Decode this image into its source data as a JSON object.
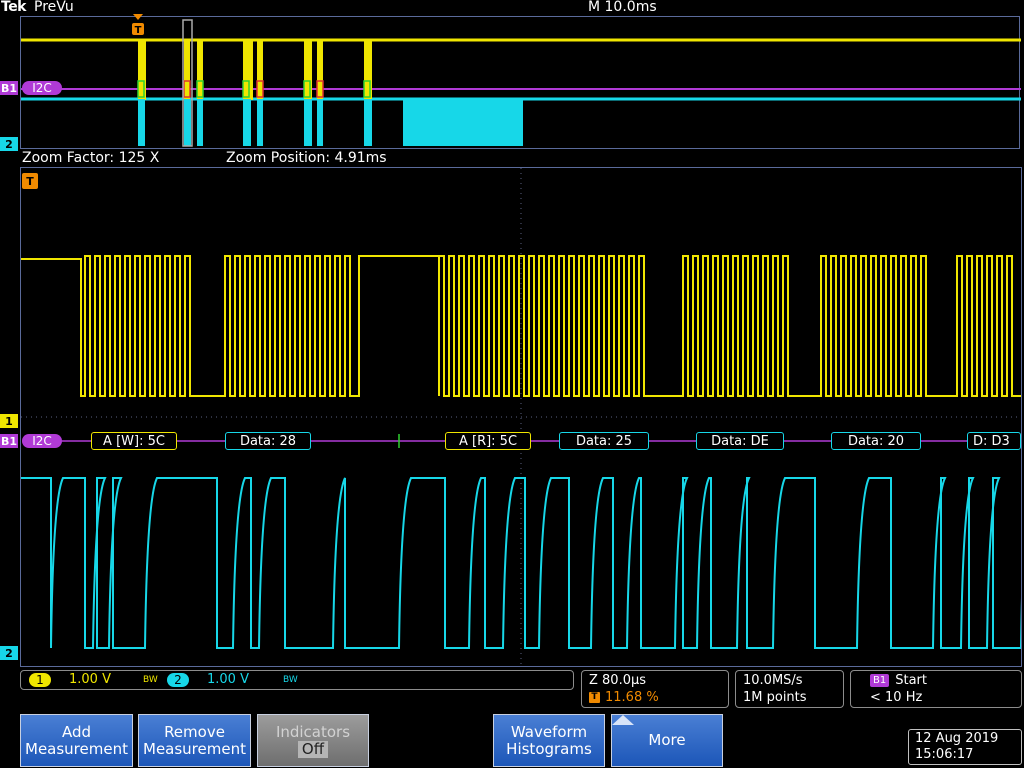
{
  "header": {
    "brand": "Tek",
    "mode": "PreVu",
    "timebase": "M 10.0ms"
  },
  "overview": {
    "trigger_marker": "T",
    "bus_label": "I2C",
    "bus_marker": "B1",
    "ch1_marker": "1",
    "ch2_marker": "2"
  },
  "zoom": {
    "factor_label": "Zoom Factor: 125 X",
    "position_label": "Zoom Position: 4.91ms"
  },
  "main": {
    "trigger_marker": "T",
    "ch1_marker": "1",
    "ch2_marker": "2",
    "bus_marker": "B1",
    "bus_label": "I2C",
    "decode_packets": [
      {
        "text": "A [W]: 5C",
        "kind": "address"
      },
      {
        "text": "Data: 28",
        "kind": "data"
      },
      {
        "text": "A [R]: 5C",
        "kind": "address"
      },
      {
        "text": "Data: 25",
        "kind": "data"
      },
      {
        "text": "Data: DE",
        "kind": "data"
      },
      {
        "text": "Data: 20",
        "kind": "data"
      },
      {
        "text": "D: D3",
        "kind": "data"
      }
    ]
  },
  "status": {
    "ch1": {
      "num": "1",
      "volts": "1.00 V",
      "bw": "BW"
    },
    "ch2": {
      "num": "2",
      "volts": "1.00 V",
      "bw": "BW"
    },
    "zoom_time": "Z 80.0µs",
    "trigger_pos": "11.68 %",
    "trigger_icon": "T",
    "sample_rate": "10.0MS/s",
    "record_length": "1M points",
    "bus_tag": "B1",
    "bus_state": "Start",
    "freq": "< 10 Hz"
  },
  "buttons": {
    "add": [
      "Add",
      "Measurement"
    ],
    "remove": [
      "Remove",
      "Measurement"
    ],
    "indicators": [
      "Indicators",
      "Off"
    ],
    "histograms": [
      "Waveform",
      "Histograms"
    ],
    "more": "More"
  },
  "datetime": {
    "date": "12 Aug 2019",
    "time": "15:06:17"
  },
  "colors": {
    "ch1": "#f0e600",
    "ch2": "#17d7e8",
    "bus": "#b03ad6",
    "grid": "#4a5575"
  }
}
